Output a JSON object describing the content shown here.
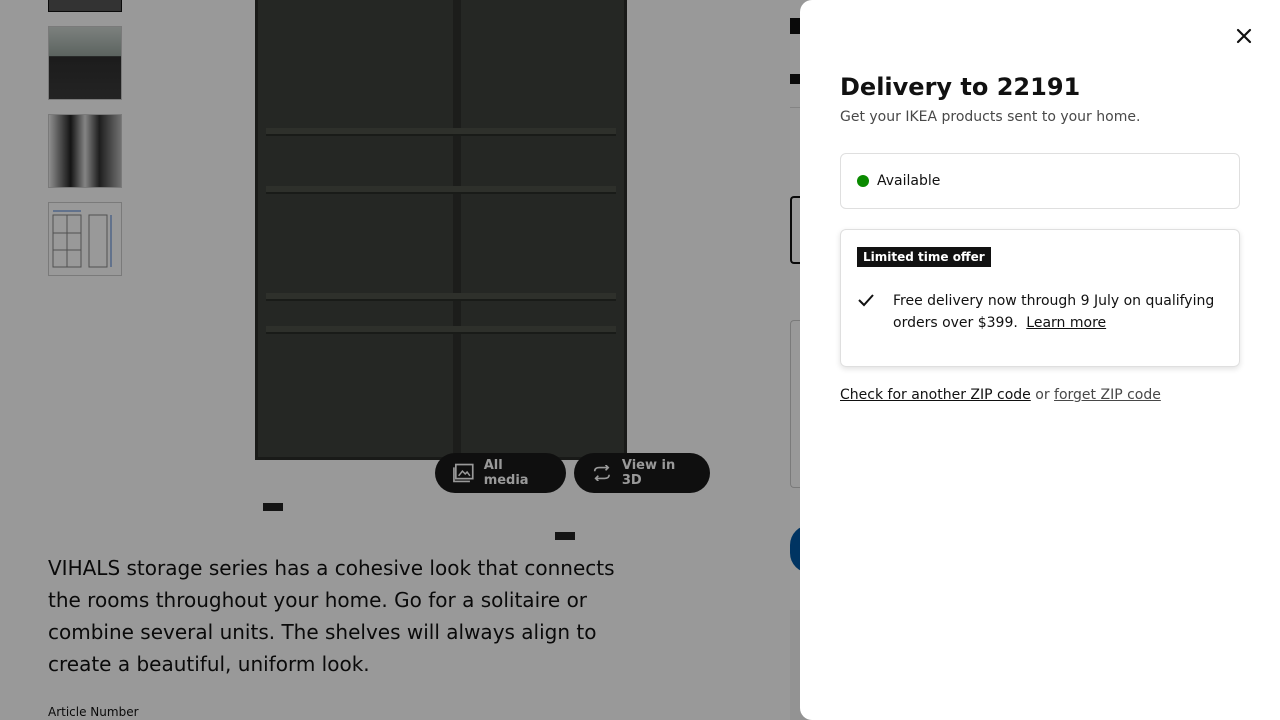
{
  "product": {
    "description": "VIHALS storage series has a cohesive look that connects the rooms throughout your home. Go for a solitaire or combine several units. The shelves will always align to create a beautiful, uniform look.",
    "article_number_label": "Article Number"
  },
  "gallery": {
    "all_media_label": "All media",
    "view_3d_label": "View in 3D"
  },
  "delivery_panel": {
    "title": "Delivery to 22191",
    "subtitle": "Get your IKEA products sent to your home.",
    "availability": {
      "label": "Available",
      "status_color": "#0a8a00"
    },
    "offer": {
      "badge": "Limited time offer",
      "text": "Free delivery now through 9 July on qualifying orders over $399.",
      "link": "Learn more"
    },
    "zip": {
      "check_link": "Check for another ZIP code",
      "separator": "or",
      "forget_link": "forget ZIP code"
    }
  },
  "icons": {
    "close": "close-icon",
    "check": "check-icon",
    "media": "gallery-icon",
    "rotate": "rotate-3d-icon"
  }
}
